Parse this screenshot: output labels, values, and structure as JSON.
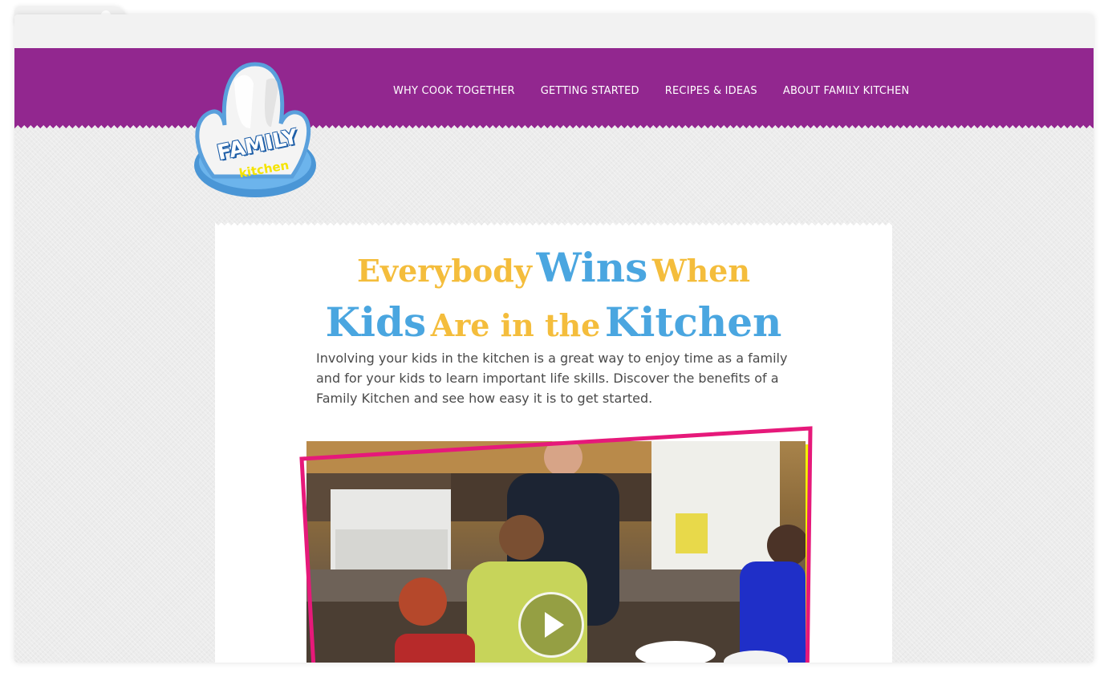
{
  "nav": {
    "items": [
      "WHY COOK TOGETHER",
      "GETTING STARTED",
      "RECIPES & IDEAS",
      "ABOUT FAMILY KITCHEN"
    ]
  },
  "logo": {
    "line1": "FAMILY",
    "line2": "kitchen"
  },
  "hero": {
    "headline": {
      "w1": "Everybody",
      "w2": "Wins",
      "w3": "When",
      "w4": "Kids",
      "w5": "Are in the",
      "w6": "Kitchen"
    },
    "intro": "Involving your kids in the kitchen is a great way to enjoy time as a family and for your kids to learn important life skills. Discover the benefits of a Family Kitchen and see how easy it is to get started."
  },
  "video": {
    "play_icon": "play-icon"
  },
  "colors": {
    "header": "#92278f",
    "headline_yellow": "#f4bd3c",
    "headline_blue": "#4aa6e0",
    "frame_pink": "#e6197a",
    "frame_yellow": "#f5f000"
  }
}
